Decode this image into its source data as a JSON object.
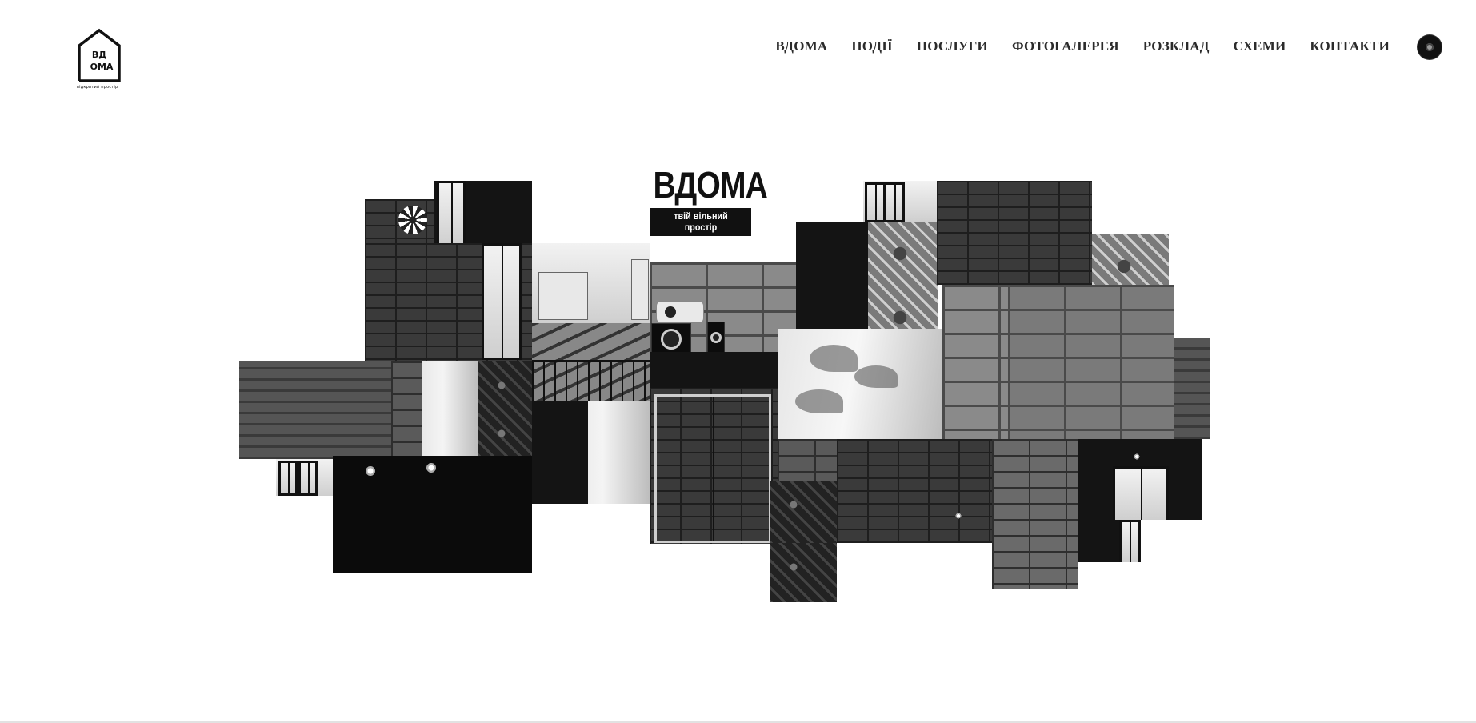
{
  "header": {
    "logo": {
      "mark_text_top": "ВД",
      "mark_text_bottom": "ОМА",
      "tagline": "відкритий простір"
    },
    "nav": [
      {
        "label": "ВДОМА"
      },
      {
        "label": "ПОДІЇ"
      },
      {
        "label": "ПОСЛУГИ"
      },
      {
        "label": "ФОТОГАЛЕРЕЯ"
      },
      {
        "label": "РОЗКЛАД"
      },
      {
        "label": "СХЕМИ"
      },
      {
        "label": "КОНТАКТИ"
      }
    ]
  },
  "hero": {
    "title": "ВДОМА",
    "subtitle": "твій вільний простір"
  },
  "colors": {
    "text": "#2b2b2b",
    "background": "#ffffff",
    "accent": "#111111"
  }
}
